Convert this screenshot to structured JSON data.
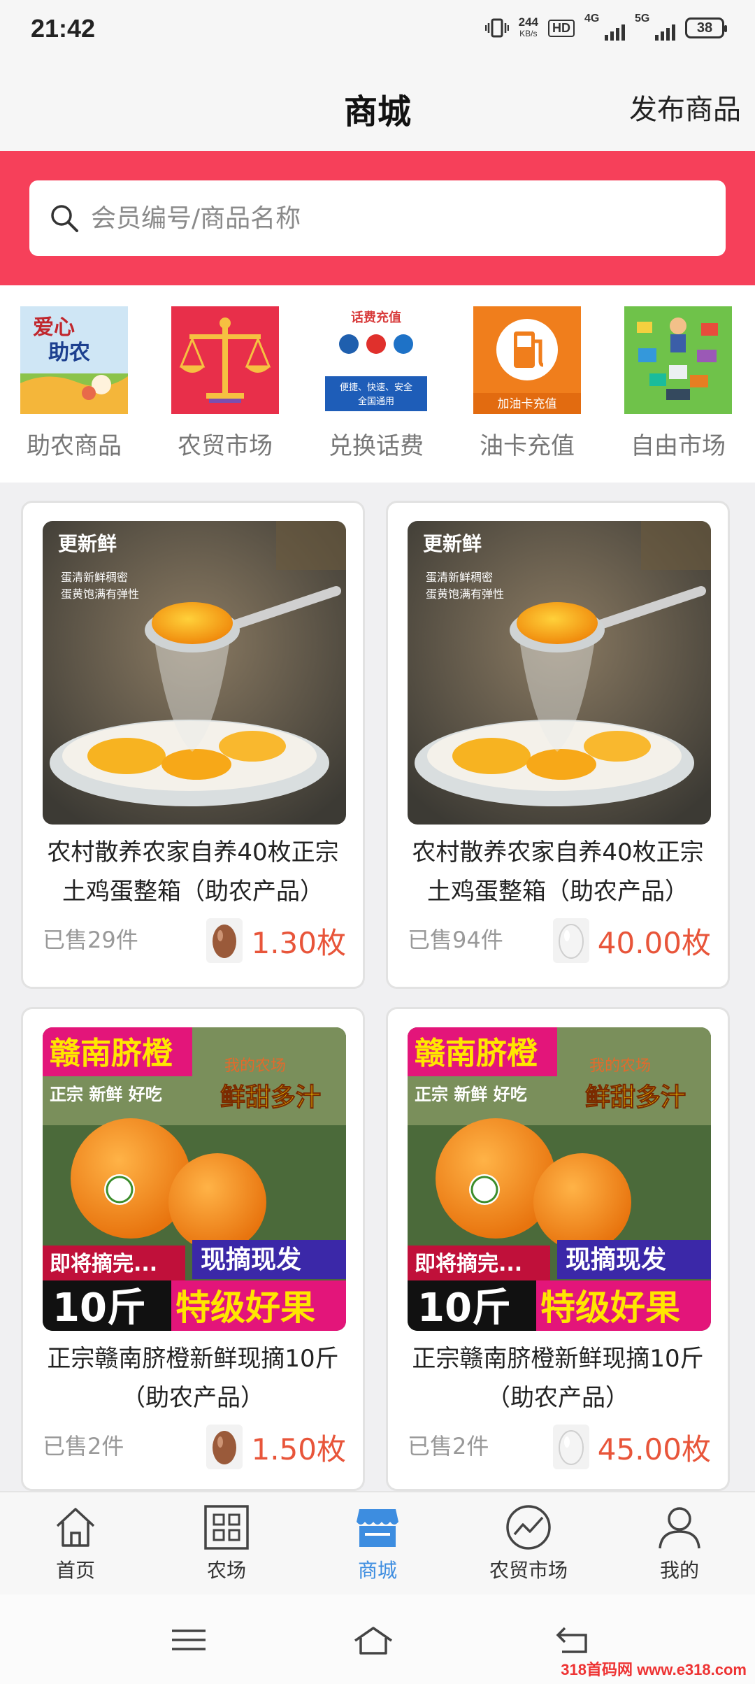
{
  "status_bar": {
    "time": "21:42",
    "speed_value": "244",
    "speed_unit": "KB/s",
    "hd": "HD",
    "net1": "4G",
    "net2": "5G",
    "battery": "38"
  },
  "header": {
    "title": "商城",
    "publish_label": "发布商品"
  },
  "search": {
    "placeholder": "会员编号/商品名称"
  },
  "categories": [
    {
      "label": "助农商品",
      "icon": "farm-help-icon"
    },
    {
      "label": "农贸市场",
      "icon": "scale-icon"
    },
    {
      "label": "兑换话费",
      "icon": "phone-recharge-icon"
    },
    {
      "label": "油卡充值",
      "icon": "fuel-card-icon"
    },
    {
      "label": "自由市场",
      "icon": "free-market-icon"
    }
  ],
  "products": [
    {
      "title": "农村散养农家自养40枚正宗土鸡蛋整箱（助农产品）",
      "sold": "已售29件",
      "price": "1.30枚",
      "egg": "golden-egg-icon",
      "image_badge": "更新鲜",
      "image_text1": "蛋清新鲜稠密",
      "image_text2": "蛋黄饱满有弹性"
    },
    {
      "title": "农村散养农家自养40枚正宗土鸡蛋整箱（助农产品）",
      "sold": "已售94件",
      "price": "40.00枚",
      "egg": "white-egg-icon",
      "image_badge": "更新鲜",
      "image_text1": "蛋清新鲜稠密",
      "image_text2": "蛋黄饱满有弹性"
    },
    {
      "title": "正宗赣南脐橙新鲜现摘10斤（助农产品）",
      "sold": "已售2件",
      "price": "1.50枚",
      "egg": "golden-egg-icon",
      "image_title": "赣南脐橙",
      "image_sub": "正宗 新鲜 好吃",
      "image_tag": "鲜甜多汁",
      "image_farm": "我的农场",
      "image_pick": "即将摘完...",
      "image_fresh": "现摘现发",
      "image_weight": "10斤",
      "image_grade": "特级好果"
    },
    {
      "title": "正宗赣南脐橙新鲜现摘10斤（助农产品）",
      "sold": "已售2件",
      "price": "45.00枚",
      "egg": "white-egg-icon",
      "image_title": "赣南脐橙",
      "image_sub": "正宗 新鲜 好吃",
      "image_tag": "鲜甜多汁",
      "image_farm": "我的农场",
      "image_pick": "即将摘完...",
      "image_fresh": "现摘现发",
      "image_weight": "10斤",
      "image_grade": "特级好果"
    }
  ],
  "bottom_nav": [
    {
      "label": "首页",
      "icon": "home-icon"
    },
    {
      "label": "农场",
      "icon": "grid-icon"
    },
    {
      "label": "商城",
      "icon": "shop-icon",
      "active": true
    },
    {
      "label": "农贸市场",
      "icon": "trend-icon"
    },
    {
      "label": "我的",
      "icon": "user-icon"
    }
  ],
  "watermark": "318首码网 www.e318.com",
  "colors": {
    "accent": "#f6405a",
    "price": "#e8553a",
    "nav_active": "#3d8de0"
  }
}
